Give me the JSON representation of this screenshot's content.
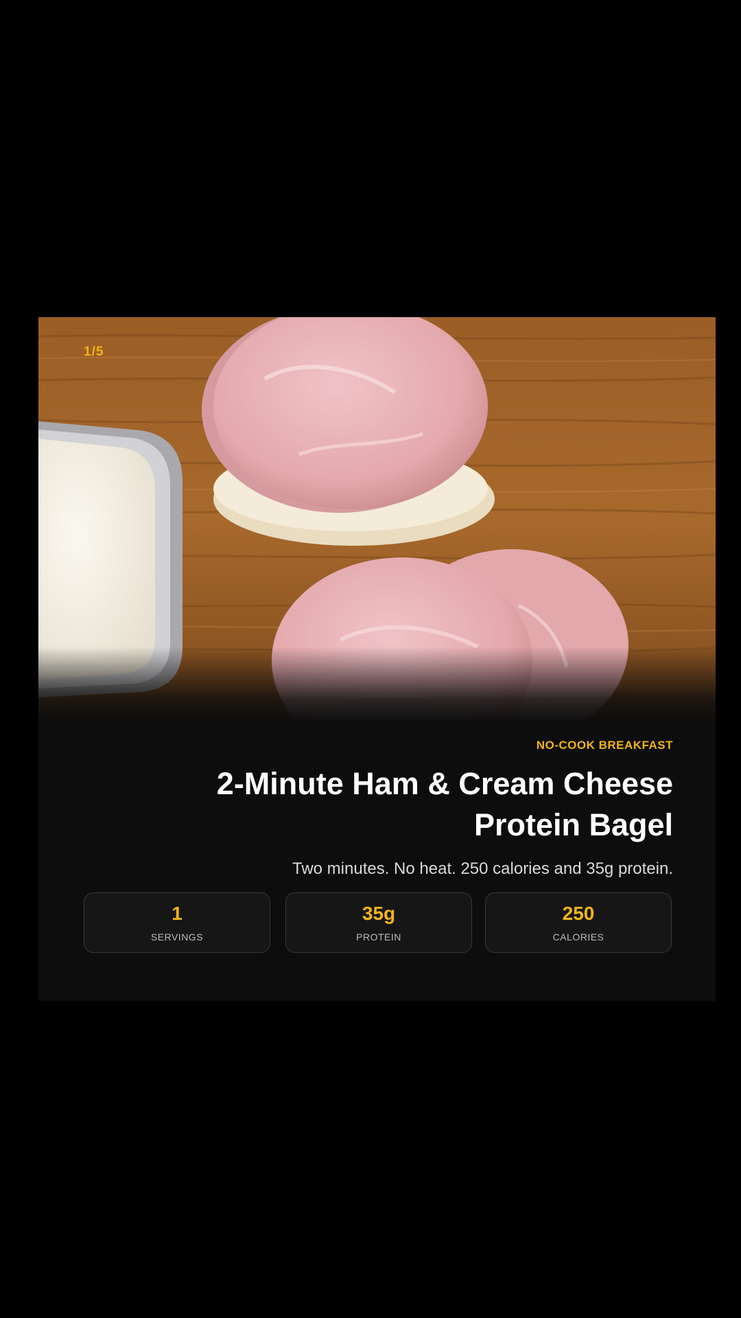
{
  "slide": {
    "counter": "1/5"
  },
  "recipe": {
    "category": "NO-COOK BREAKFAST",
    "title": "2-Minute Ham & Cream Cheese Protein Bagel",
    "description": "Two minutes. No heat. 250 calories and 35g protein."
  },
  "stats": [
    {
      "value": "250",
      "label": "CALORIES"
    },
    {
      "value": "35g",
      "label": "PROTEIN"
    },
    {
      "value": "1",
      "label": "SERVINGS"
    }
  ],
  "colors": {
    "accent": "#f2b418",
    "background": "#000000",
    "card": "#0d0d0d"
  }
}
